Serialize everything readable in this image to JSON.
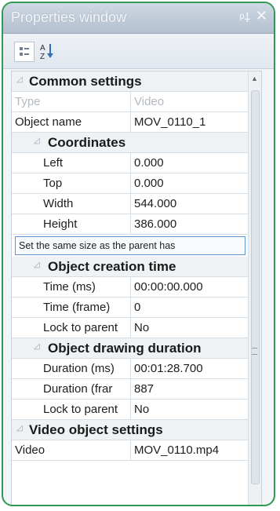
{
  "window": {
    "title": "Properties window",
    "pin_icon": "pin-icon",
    "close_icon": "close-icon"
  },
  "toolbar": {
    "buttons": [
      "categorized-view-icon",
      "sort-alphabetical-icon"
    ]
  },
  "grid": {
    "common": {
      "label": "Common settings",
      "rows": [
        {
          "name": "Type",
          "value": "Video",
          "disabled": true
        },
        {
          "name": "Object name",
          "value": "MOV_0110_1"
        }
      ]
    },
    "coordinates": {
      "label": "Coordinates",
      "rows": [
        {
          "name": "Left",
          "value": "0.000"
        },
        {
          "name": "Top",
          "value": "0.000"
        },
        {
          "name": "Width",
          "value": "544.000"
        },
        {
          "name": "Height",
          "value": "386.000"
        }
      ]
    },
    "link": "Set the same size as the parent has",
    "creation": {
      "label": "Object creation time",
      "rows": [
        {
          "name": "Time (ms)",
          "value": "00:00:00.000"
        },
        {
          "name": "Time (frame)",
          "value": "0"
        },
        {
          "name": "Lock to parent",
          "value": "No"
        }
      ]
    },
    "drawing": {
      "label": "Object drawing duration",
      "rows": [
        {
          "name": "Duration (ms)",
          "value": "00:01:28.700"
        },
        {
          "name": "Duration (frar",
          "value": "887"
        },
        {
          "name": "Lock to parent",
          "value": "No"
        }
      ]
    },
    "video": {
      "label": "Video object settings",
      "rows": [
        {
          "name": "Video",
          "value": "MOV_0110.mp4"
        }
      ]
    }
  }
}
